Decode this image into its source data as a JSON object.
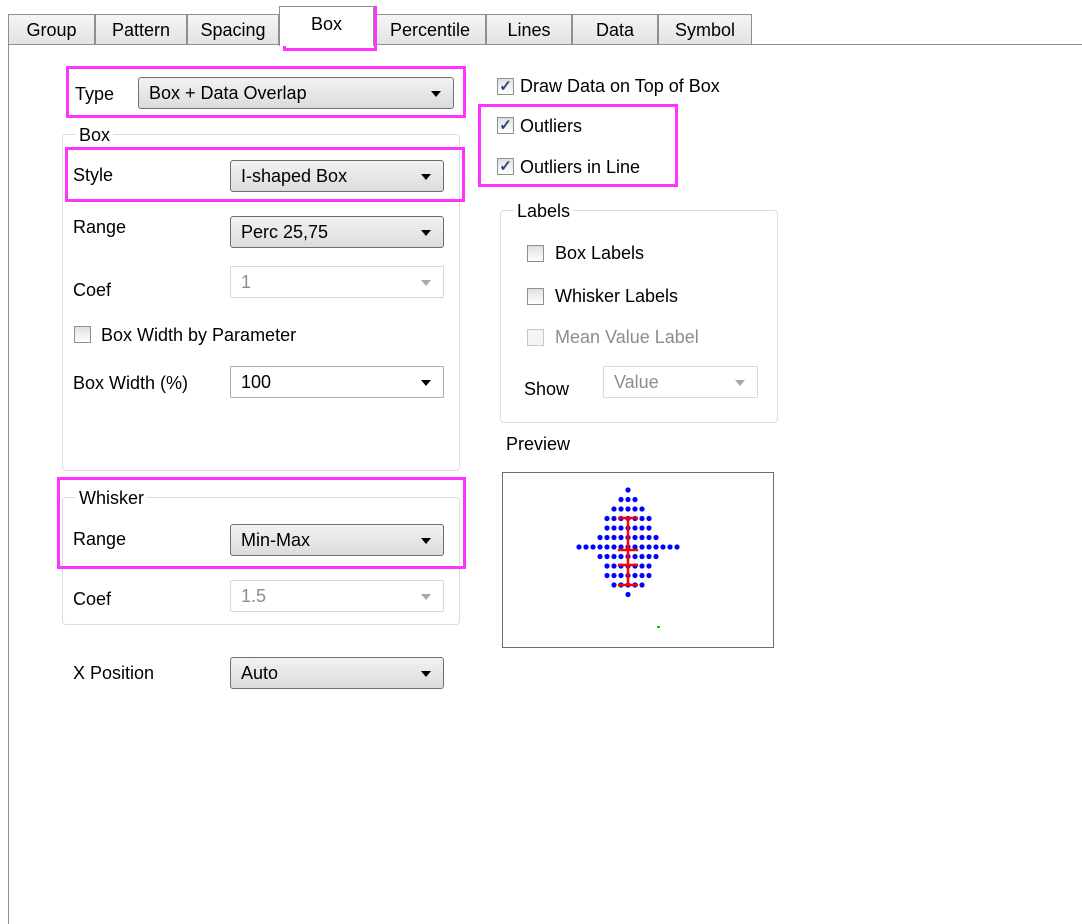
{
  "tabs": [
    "Group",
    "Pattern",
    "Spacing",
    "Box",
    "Percentile",
    "Lines",
    "Data",
    "Symbol"
  ],
  "active_tab": "Box",
  "type": {
    "label": "Type",
    "value": "Box + Data Overlap"
  },
  "box_group": {
    "title": "Box",
    "style": {
      "label": "Style",
      "value": "I-shaped Box"
    },
    "range": {
      "label": "Range",
      "value": "Perc 25,75"
    },
    "coef": {
      "label": "Coef",
      "value": "1"
    },
    "width_by_param": {
      "label": "Box Width by Parameter",
      "checked": false
    },
    "box_width": {
      "label": "Box Width (%)",
      "value": "100"
    }
  },
  "whisker_group": {
    "title": "Whisker",
    "range": {
      "label": "Range",
      "value": "Min-Max"
    },
    "coef": {
      "label": "Coef",
      "value": "1.5"
    }
  },
  "x_position": {
    "label": "X Position",
    "value": "Auto"
  },
  "checks": {
    "draw_on_top": {
      "label": "Draw Data on Top of Box",
      "checked": true
    },
    "outliers": {
      "label": "Outliers",
      "checked": true
    },
    "outliers_in_line": {
      "label": "Outliers in Line",
      "checked": true
    }
  },
  "labels_group": {
    "title": "Labels",
    "box_labels": {
      "label": "Box Labels",
      "checked": false
    },
    "whisker_labels": {
      "label": "Whisker Labels",
      "checked": false
    },
    "mean_value_label": {
      "label": "Mean Value Label",
      "checked": false,
      "disabled": true
    },
    "show": {
      "label": "Show",
      "value": "Value"
    }
  },
  "preview": {
    "label": "Preview",
    "dot_color": "#0000ff",
    "box_color": "#ff0000",
    "mark_color": "#00cc00"
  },
  "highlight_color": "#ff33ff",
  "check_mark": "✓"
}
